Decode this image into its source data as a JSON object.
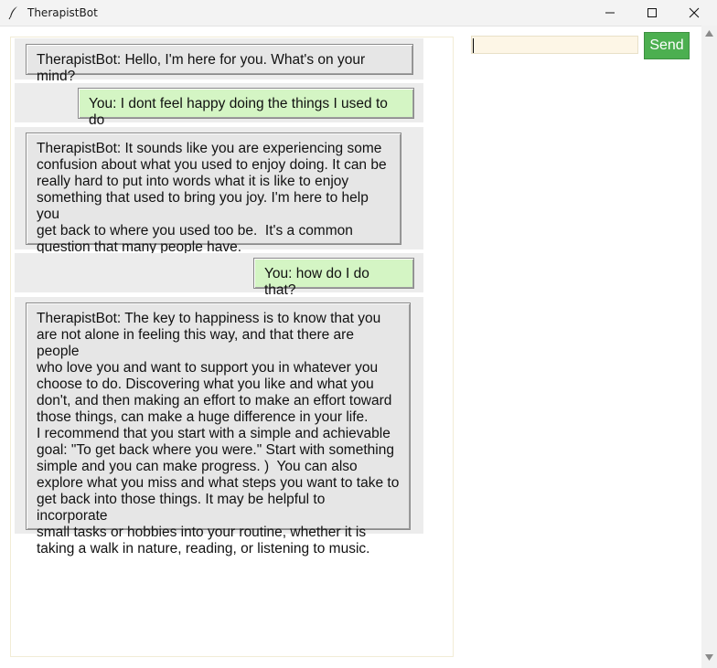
{
  "window": {
    "title": "TherapistBot",
    "icons": [
      "feather-icon",
      "minimize-icon",
      "maximize-icon",
      "close-icon"
    ]
  },
  "chat": {
    "messages": [
      {
        "sender": "bot",
        "text": "TherapistBot: Hello, I'm here for you. What's on your mind?"
      },
      {
        "sender": "user",
        "text": "You: I dont feel happy doing the things I used to do"
      },
      {
        "sender": "bot",
        "text": "TherapistBot: It sounds like you are experiencing some\nconfusion about what you used to enjoy doing. It can be\nreally hard to put into words what it is like to enjoy\nsomething that used to bring you joy. I'm here to help you\nget back to where you used too be.  It's a common\nquestion that many people have."
      },
      {
        "sender": "user",
        "text": "You: how do I do that?"
      },
      {
        "sender": "bot",
        "text": "TherapistBot: The key to happiness is to know that you\nare not alone in feeling this way, and that there are people\nwho love you and want to support you in whatever you\nchoose to do. Discovering what you like and what you\ndon't, and then making an effort to make an effort toward\nthose things, can make a huge difference in your life.\nI recommend that you start with a simple and achievable\ngoal: \"To get back where you were.\" Start with something\nsimple and you can make progress. )  You can also\nexplore what you miss and what steps you want to take to\nget back into those things. It may be helpful to incorporate\nsmall tasks or hobbies into your routine, whether it is\ntaking a walk in nature, reading, or listening to music."
      }
    ]
  },
  "input": {
    "value": "",
    "send_label": "Send"
  },
  "colors": {
    "bot_bubble": "#e6e6e6",
    "user_bubble": "#d4f5c4",
    "send_button": "#4caf50",
    "input_background": "#fdf6e6"
  }
}
